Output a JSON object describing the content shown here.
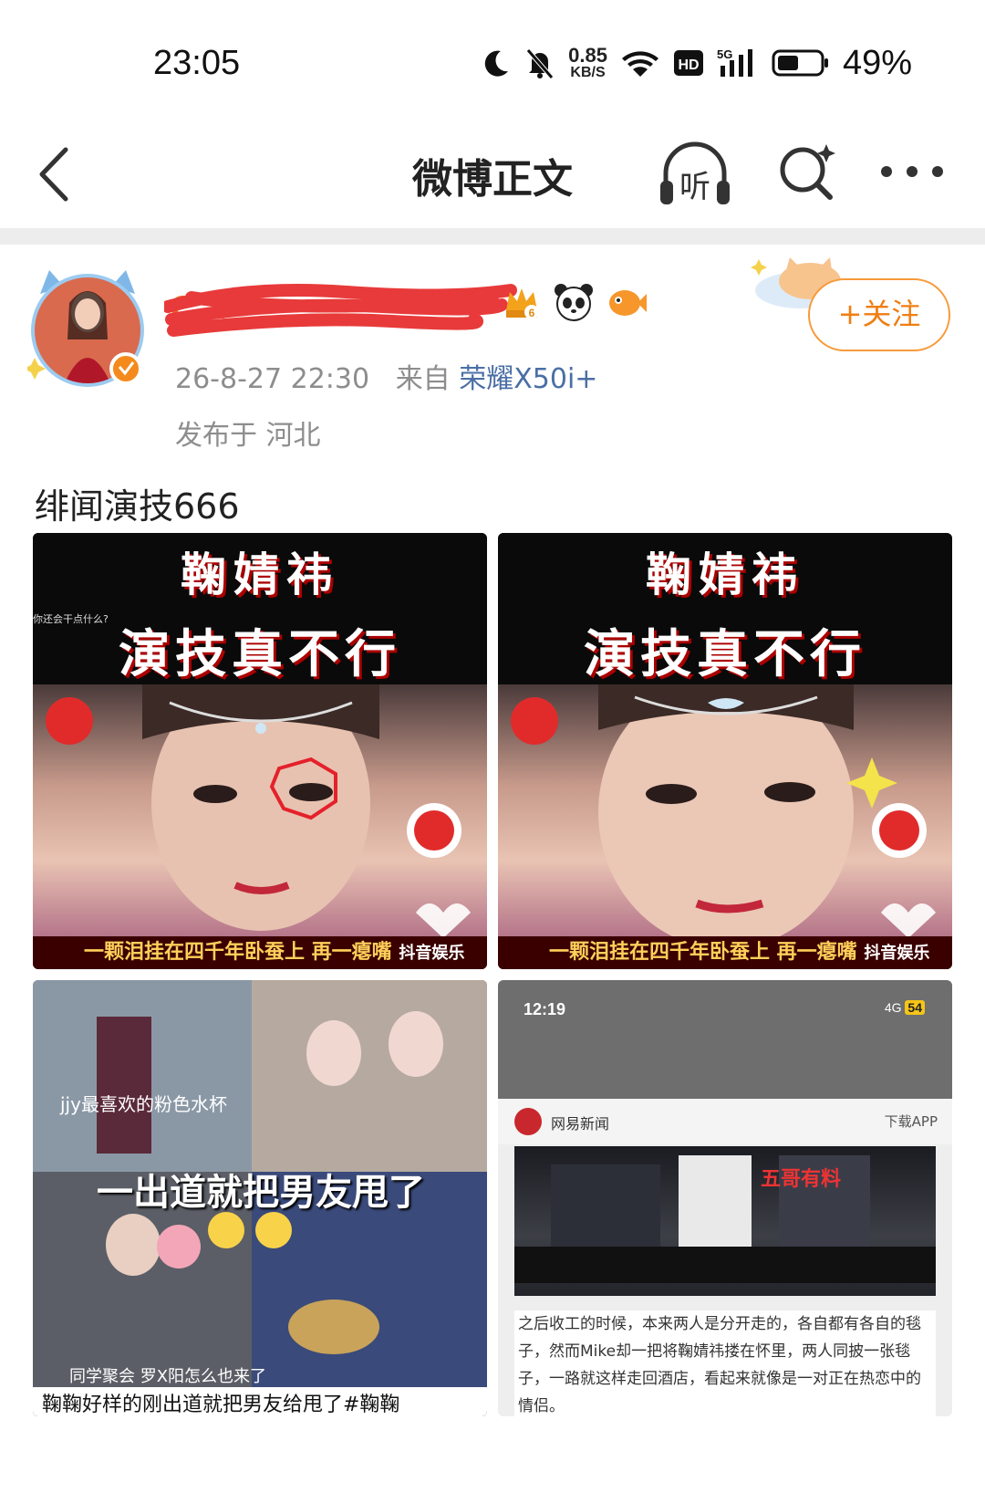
{
  "status": {
    "time": "23:05",
    "net_speed_value": "0.85",
    "net_speed_unit": "KB/S",
    "hd_label": "HD",
    "network_label": "5G",
    "battery": "49%"
  },
  "nav": {
    "title": "微博正文",
    "listen_label": "听"
  },
  "post": {
    "username": "C...",
    "badges": [
      "crown-badge-icon",
      "panda-badge-icon",
      "fish-badge-icon"
    ],
    "crown_level": "6",
    "time": "26-8-27 22:30",
    "from_prefix": "来自",
    "device": "荣耀X50i+",
    "location": "发布于 河北",
    "follow_label": "+关注",
    "text": "绯闻演技666"
  },
  "images": [
    {
      "title_top": "鞠婧祎",
      "title_bottom": "演技真不行",
      "side_text": "你还会干点什么?",
      "caption": "一颗泪挂在四千年卧蚕上  再一瘪嘴",
      "watermark": "抖音娱乐"
    },
    {
      "title_top": "鞠婧祎",
      "title_bottom": "演技真不行",
      "caption": "一颗泪挂在四千年卧蚕上  再一瘪嘴",
      "watermark": "抖音娱乐"
    },
    {
      "text_top": "jjy最喜欢的粉色水杯",
      "text_mid": "一出道就把男友甩了",
      "text_bottom": "同学聚会 罗X阳怎么也来了",
      "cap": "鞠鞠好样的刚出道就把男友给甩了#鞠鞠"
    },
    {
      "phone_time": "12:19",
      "phone_signal": "4G",
      "phone_battery": "54",
      "news_name": "网易新闻",
      "download": "下载APP",
      "pic_label": "五哥有料",
      "body": "之后收工的时候，本来两人是分开走的，各自都有各自的毯子，然而Mike却一把将鞠婧祎搂在怀里，两人同披一张毯子，一路就这样走回酒店，看起来就像是一对正在热恋中的情侣。"
    }
  ]
}
